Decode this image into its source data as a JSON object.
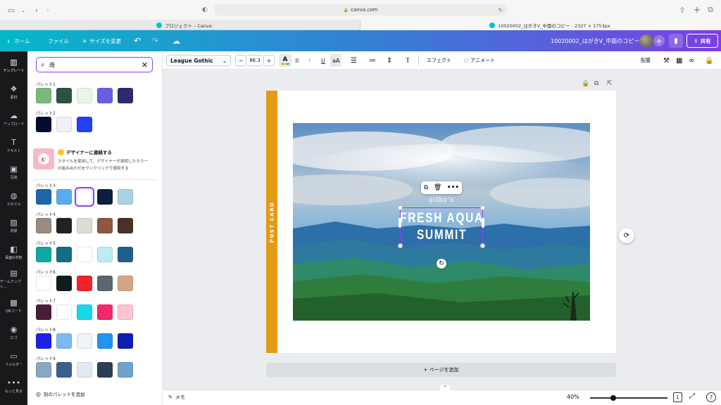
{
  "browser": {
    "url": "canva.com",
    "tabs": [
      {
        "title": "プロジェクト – Canva",
        "active": false
      },
      {
        "title": "10020002_はがきV_中面のコピー - 2327 × 1753px",
        "active": true
      }
    ]
  },
  "header": {
    "home": "ホーム",
    "file": "ファイル",
    "resize": "サイズを変更",
    "doc_title": "10020002_はがきV_中面のコピー",
    "share": "共有",
    "colors": {
      "gradient_start": "#05b8c9",
      "gradient_end": "#7b3fe4"
    }
  },
  "rail": [
    {
      "label": "テンプレート",
      "icon": "template-icon",
      "active": true
    },
    {
      "label": "素材",
      "icon": "elements-icon"
    },
    {
      "label": "アップロード",
      "icon": "upload-icon"
    },
    {
      "label": "テキスト",
      "icon": "text-icon"
    },
    {
      "label": "写真",
      "icon": "photo-icon"
    },
    {
      "label": "スタイル",
      "icon": "palette-icon"
    },
    {
      "label": "背景",
      "icon": "background-icon"
    },
    {
      "label": "図面&学術",
      "icon": "app-icon"
    },
    {
      "label": "チームテンプレ...",
      "icon": "team-template-icon"
    },
    {
      "label": "QRコード",
      "icon": "qr-icon"
    },
    {
      "label": "ロゴ",
      "icon": "logo-icon"
    },
    {
      "label": "フォルダー",
      "icon": "folder-icon"
    },
    {
      "label": "もっと見る",
      "icon": "more-icon"
    }
  ],
  "panel": {
    "search_value": "콰",
    "promo_title": "デザイナーに連絡する",
    "promo_desc_1": "スタイルを使用して、デザイナーが承認したカラー",
    "promo_desc_2": "の組み合わせをワンクリックで適用する",
    "add_palette": "別のパレットを追加",
    "palettes": [
      {
        "label": "パレット1",
        "colors": [
          "#7cb87a",
          "#2f5240",
          "#eaf5e6",
          "#6d5de6",
          "#2d2a6e"
        ]
      },
      {
        "label": "パレット2",
        "colors": [
          "#050b2e",
          "#eff1f7",
          "#2440f5"
        ]
      },
      {
        "label": "パレット3",
        "colors": [
          "#1e66a8",
          "#5aaaf2",
          "#ffffff",
          "#0d1e40",
          "#a9d2e2"
        ],
        "selected": 2
      },
      {
        "label": "パレット4",
        "colors": [
          "#9a8a80",
          "#222222",
          "#dedbd5",
          "#8e573e",
          "#4a3127"
        ]
      },
      {
        "label": "パレット5",
        "colors": [
          "#10a7a3",
          "#126d85",
          "#ffffff",
          "#bdeaf5",
          "#1d5f90"
        ]
      },
      {
        "label": "パレット6",
        "colors": [
          "#ffffff",
          "#0f1d1f",
          "#f0222b",
          "#5b6771",
          "#d3a584"
        ]
      },
      {
        "label": "パレット7",
        "colors": [
          "#4a1d36",
          "#ffffff",
          "#16d8e9",
          "#f4276d",
          "#fcc3d2"
        ]
      },
      {
        "label": "パレット8",
        "colors": [
          "#1a22e6",
          "#7cb9f0",
          "#eef3f8",
          "#1f94f0",
          "#0f1eb0"
        ]
      },
      {
        "label": "パレット9",
        "colors": [
          "#89a7c1",
          "#386089",
          "#e2e9f0",
          "#2c3e57",
          "#6fa3cc"
        ]
      }
    ]
  },
  "toolbar": {
    "font": "League Gothic",
    "font_size": "86.3",
    "minus": "−",
    "plus": "+",
    "bold": "B",
    "italic": "I",
    "underline": "U",
    "case": "aA",
    "effects": "エフェクト",
    "animate": "アニメート",
    "position": "配置"
  },
  "canvas": {
    "spine_text": "POST CARD",
    "subtitle": "gilby's",
    "title_line1": "FRESH AQUA",
    "title_line2": "SUMMIT",
    "spine_color": "#e59a16",
    "add_page": "+ ページを追加"
  },
  "bottom": {
    "notes": "メモ",
    "zoom": "40%",
    "zoom_fraction": 0.3,
    "page_num": "1"
  }
}
